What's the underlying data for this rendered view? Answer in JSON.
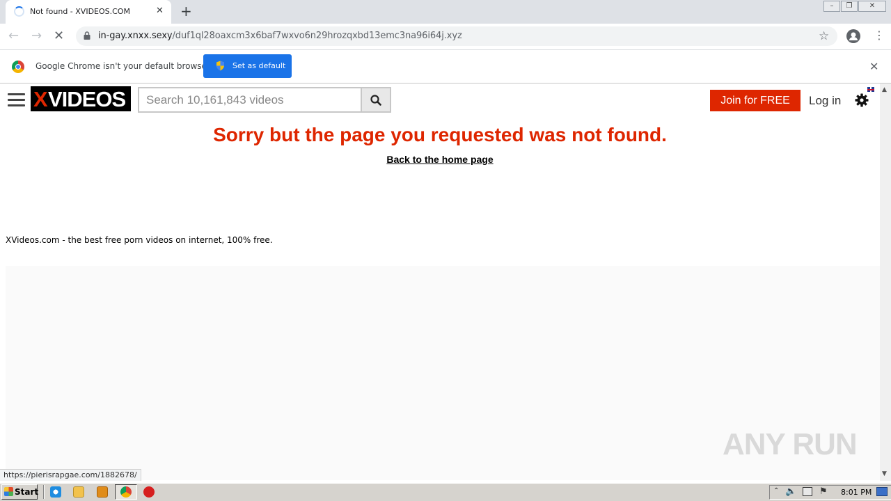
{
  "browser": {
    "tab_title": "Not found - XVIDEOS.COM",
    "tab_close": "✕",
    "new_tab": "+",
    "url_host": "in-gay.xnxx.sexy",
    "url_path": "/duf1ql28oaxcm3x6baf7wxvo6n29hrozqxbd13emc3na96i64j.xyz",
    "infobar_text": "Google Chrome isn't your default browser",
    "set_default_label": "Set as default",
    "status_url": "https://pierisrapgae.com/1882678/"
  },
  "site": {
    "logo_x": "X",
    "logo_rest": "VIDEOS",
    "search_placeholder": "Search 10,161,843 videos",
    "join_label": "Join for FREE",
    "login_label": "Log in",
    "error_title": "Sorry but the page you requested was not found.",
    "home_link": "Back to the home page",
    "tagline": "XVideos.com - the best free porn videos on internet, 100% free."
  },
  "watermark": "ANY RUN",
  "taskbar": {
    "start_label": "Start",
    "clock": "8:01 PM"
  },
  "colors": {
    "brand_red": "#de2600",
    "chrome_blue": "#1a73e8"
  },
  "icons": [
    "loading-spinner-icon",
    "back-icon",
    "forward-icon",
    "stop-icon",
    "lock-icon",
    "star-icon",
    "profile-icon",
    "menu-dots-icon",
    "chrome-logo-icon",
    "shield-icon",
    "close-icon",
    "hamburger-icon",
    "search-icon",
    "gear-icon",
    "uk-flag-icon",
    "windows-flag-icon"
  ]
}
